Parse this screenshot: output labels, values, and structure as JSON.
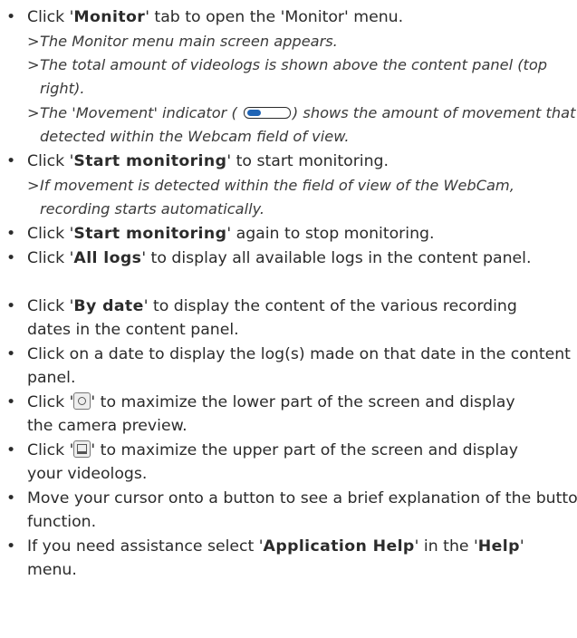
{
  "bullet_char": "•",
  "note_marker": ">",
  "toggle_indicator": {
    "icon": "movement-indicator-toggle",
    "fill_color": "#1f64b5"
  },
  "items": [
    {
      "pre": "Click '",
      "bold": "Monitor",
      "post": "' tab to open the 'Monitor' menu."
    },
    {
      "note": "The Monitor menu main screen appears."
    },
    {
      "note": "The total amount of videologs is shown above the content panel (top right)."
    },
    {
      "note_pre": "The 'Movement' indicator (",
      "note_post": ") shows the amount of movement that is detected within the Webcam field of view."
    },
    {
      "pre": "Click '",
      "bold": "Start monitoring",
      "post": "' to start monitoring."
    },
    {
      "note": "If movement is detected within the field of view of the WebCam, recording starts automatically."
    },
    {
      "pre": "Click '",
      "bold": "Start monitoring",
      "post": "' again to stop monitoring."
    },
    {
      "pre": "Click '",
      "bold": "All logs",
      "post": "' to display all available logs in the content panel."
    },
    {
      "pre": "Click '",
      "bold": "By date",
      "post": "' to display the content of the various recording dates in the content panel."
    },
    {
      "text": "Click on a date to display the log(s) made on that date in the content panel."
    },
    {
      "pre": "Click '",
      "icon": "camera-preview-icon",
      "post": "' to maximize the lower part of the screen and display the camera preview."
    },
    {
      "pre": "Click '",
      "icon": "videolog-screen-icon",
      "post": "' to maximize the upper part of the screen and display your videologs."
    },
    {
      "text": "Move your cursor onto a button to see a brief explanation of the button function."
    },
    {
      "pre": "If you need assistance select '",
      "bold": "Application Help",
      "mid": "' in the '",
      "bold2": "Help",
      "post": "' menu."
    }
  ]
}
